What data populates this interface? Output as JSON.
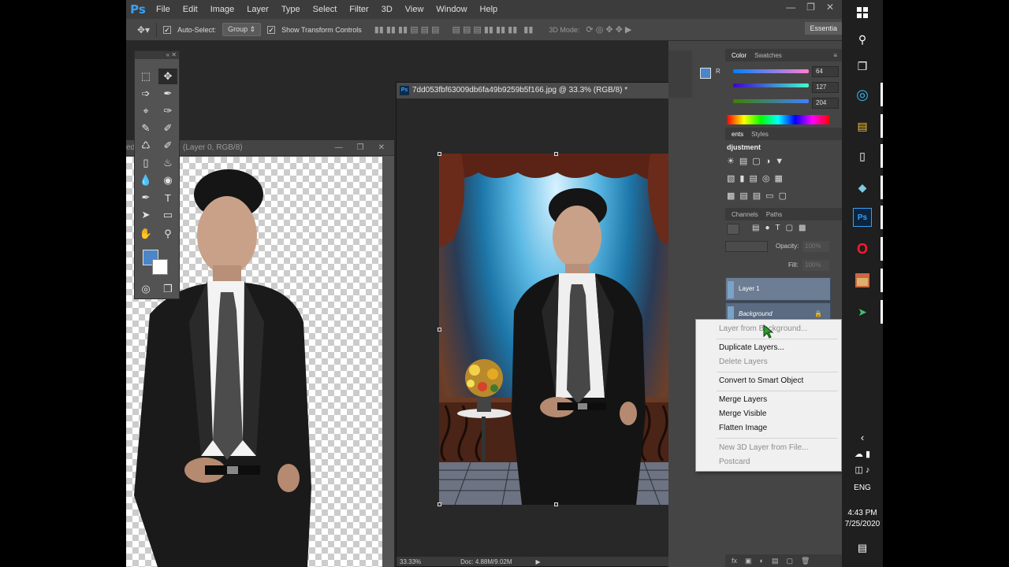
{
  "app": {
    "logo": "Ps",
    "menu": [
      "File",
      "Edit",
      "Image",
      "Layer",
      "Type",
      "Select",
      "Filter",
      "3D",
      "View",
      "Window",
      "Help"
    ]
  },
  "options_bar": {
    "auto_select_label": "Auto-Select:",
    "auto_select_value": "Group",
    "show_transform_label": "Show Transform Controls",
    "mode_label": "3D Mode:",
    "workspace": "Essentia"
  },
  "doc1": {
    "title": "(Layer 0, RGB/8)",
    "title_prefix": "ed"
  },
  "doc2": {
    "title": "7dd053fbf63009db6fa49b9259b5f166.jpg @ 33.3% (RGB/8) *",
    "zoom": "33.33%",
    "doc_size": "Doc: 4.88M/9.02M"
  },
  "color_panel": {
    "tabs": [
      "Color",
      "Swatches"
    ],
    "r_label": "R",
    "r": "64",
    "g": "127",
    "b": "204",
    "fg": "#4a86c8"
  },
  "adjustments_panel": {
    "tabs": [
      "ents",
      "Styles"
    ],
    "title": "djustment"
  },
  "layers_panel": {
    "tabs": [
      "Channels",
      "Paths"
    ],
    "opacity_label": "Opacity:",
    "opacity_value": "100%",
    "fill_label": "Fill:",
    "fill_value": "100%",
    "layers": [
      "Layer 1",
      "Background"
    ]
  },
  "context_menu": {
    "items": [
      {
        "label": "Layer from Background...",
        "enabled": false
      },
      {
        "label": "Duplicate Layers...",
        "enabled": true
      },
      {
        "label": "Delete Layers",
        "enabled": false
      },
      {
        "label": "Convert to Smart Object",
        "enabled": true
      },
      {
        "label": "Merge Layers",
        "enabled": true
      },
      {
        "label": "Merge Visible",
        "enabled": true
      },
      {
        "label": "Flatten Image",
        "enabled": true
      },
      {
        "label": "New 3D Layer from File...",
        "enabled": false
      },
      {
        "label": "Postcard",
        "enabled": false
      }
    ]
  },
  "taskbar": {
    "language": "ENG",
    "time": "4:43 PM",
    "date": "7/25/2020"
  }
}
